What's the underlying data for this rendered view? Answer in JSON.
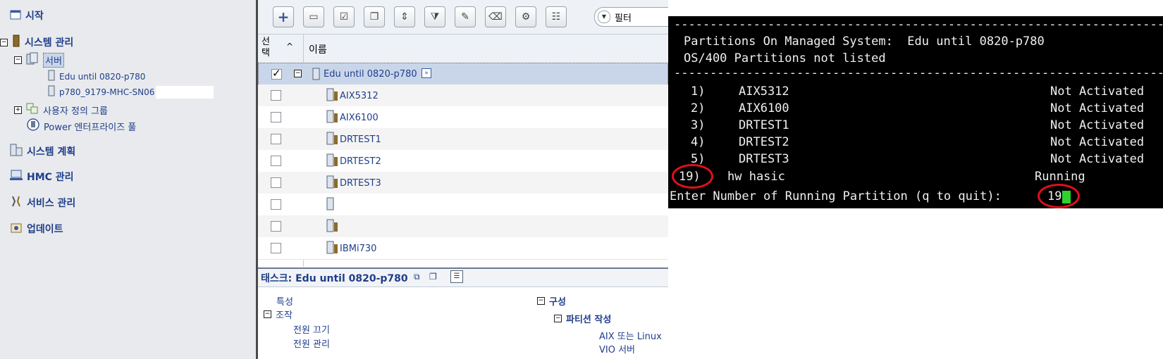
{
  "nav": {
    "items": [
      {
        "label": "시작"
      },
      {
        "label": "시스템 관리"
      },
      {
        "label": "서버"
      },
      {
        "label": "Edu until 0820-p780"
      },
      {
        "label": "p780_9179-MHC-SN06"
      },
      {
        "label": "사용자 정의 그룹"
      },
      {
        "label": "Power 엔터프라이즈 풀"
      },
      {
        "label": "시스템 계획"
      },
      {
        "label": "HMC 관리"
      },
      {
        "label": "서비스 관리"
      },
      {
        "label": "업데이트"
      }
    ]
  },
  "toolbar": {
    "filter_value": "필터"
  },
  "table": {
    "col_select": "선택",
    "col_name": "이름",
    "rows": [
      {
        "name": "Edu until 0820-p780",
        "checked": true
      },
      {
        "name": "AIX5312",
        "checked": false
      },
      {
        "name": "AIX6100",
        "checked": false
      },
      {
        "name": "DRTEST1",
        "checked": false
      },
      {
        "name": "DRTEST2",
        "checked": false
      },
      {
        "name": "DRTEST3",
        "checked": false
      },
      {
        "name": "",
        "checked": false
      },
      {
        "name": "",
        "checked": false
      },
      {
        "name": "IBMi730",
        "checked": false
      }
    ]
  },
  "tasks": {
    "title": "태스크: Edu until 0820-p780",
    "properties": "특성",
    "operations": "조작",
    "power_off": "전원 끄기",
    "power_mgmt": "전원 관리",
    "config": "구성",
    "create_partition": "파티션 작성",
    "aix_linux": "AIX 또는 Linux",
    "vio_server": "VIO 서버"
  },
  "terminal": {
    "divider": "--------------------------------------------------------------------",
    "line1": "Partitions On Managed System:  Edu until 0820-p780",
    "line2": "OS/400 Partitions not listed",
    "partitions": [
      {
        "num": "1)",
        "name": "AIX5312",
        "state": "Not Activated"
      },
      {
        "num": "2)",
        "name": "AIX6100",
        "state": "Not Activated"
      },
      {
        "num": "3)",
        "name": "DRTEST1",
        "state": "Not Activated"
      },
      {
        "num": "4)",
        "name": "DRTEST2",
        "state": "Not Activated"
      },
      {
        "num": "5)",
        "name": "DRTEST3",
        "state": "Not Activated"
      }
    ],
    "running": {
      "num": "19)",
      "name": "hw hasic",
      "state": "Running"
    },
    "prompt": "Enter Number of Running Partition (q to quit):",
    "input": "19"
  },
  "colors": {
    "link": "#1f3e8a",
    "highlight_red": "#e0101a",
    "cursor": "#2fd12f"
  }
}
